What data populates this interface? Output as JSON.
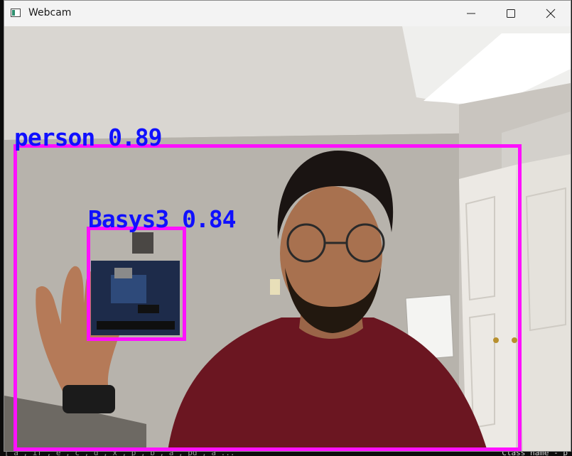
{
  "window": {
    "title": "Webcam",
    "controls": [
      "minimize-icon",
      "maximize-icon",
      "close-icon"
    ]
  },
  "detections": [
    {
      "label": "person",
      "score": "0.89",
      "text": "person 0.89",
      "color": "#ff10ff",
      "text_color": "#1010ff"
    },
    {
      "label": "Basys3",
      "score": "0.84",
      "text": "Basys3 0.84",
      "color": "#ff10ff",
      "text_color": "#1010ff"
    }
  ],
  "terminal": {
    "right_text": "Class name - p",
    "left_text": "[\"a\",\"if\",\"e\",\"c\",\"d\",\"x\",\"p\",\"b\",\"a\",\"pd\",\"a\"..."
  }
}
